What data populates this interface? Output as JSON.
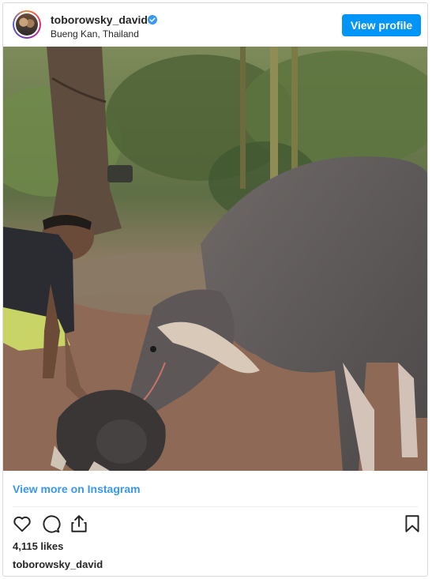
{
  "header": {
    "username": "toborowsky_david",
    "location": "Bueng Kan, Thailand",
    "verified": true,
    "view_profile_label": "View profile"
  },
  "post": {
    "image_icon": "photo-water-buffalo-with-calf",
    "view_more_label": "View more on Instagram",
    "likes": "4,115 likes",
    "caption_username": "toborowsky_david"
  },
  "actions": {
    "icons": [
      "heart-icon",
      "comment-icon",
      "share-icon",
      "bookmark-icon"
    ]
  },
  "colors": {
    "accent": "#0095f6",
    "link": "#3897f0",
    "text": "#262626"
  }
}
